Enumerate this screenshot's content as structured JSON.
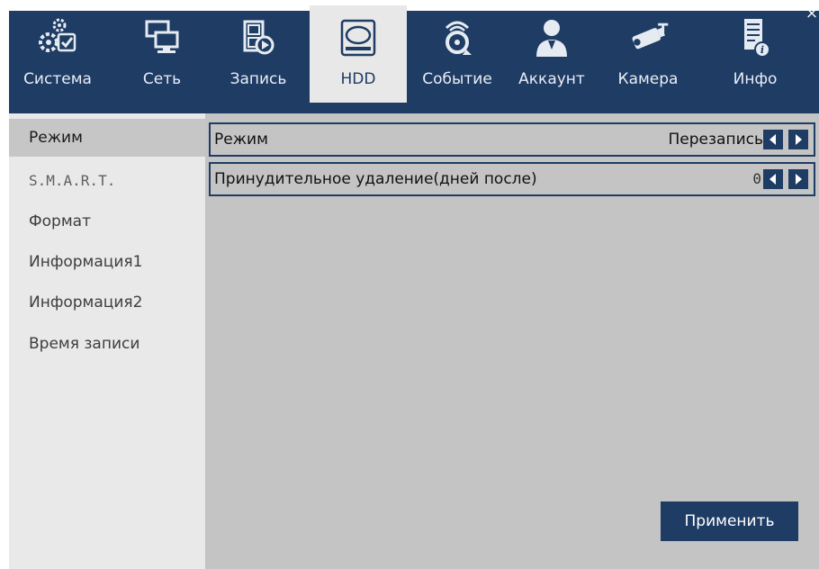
{
  "window": {
    "close_symbol": "×"
  },
  "tabs": [
    {
      "label": "Система",
      "icon": "gear-check-icon",
      "active": false
    },
    {
      "label": "Сеть",
      "icon": "network-monitors-icon",
      "active": false
    },
    {
      "label": "Запись",
      "icon": "film-record-icon",
      "active": false
    },
    {
      "label": "HDD",
      "icon": "hard-drive-icon",
      "active": true
    },
    {
      "label": "Событие",
      "icon": "alarm-event-icon",
      "active": false
    },
    {
      "label": "Аккаунт",
      "icon": "user-account-icon",
      "active": false
    },
    {
      "label": "Камера",
      "icon": "camera-icon",
      "active": false
    },
    {
      "label": "Инфо",
      "icon": "info-document-icon",
      "active": false
    }
  ],
  "sidebar": {
    "items": [
      {
        "label": "Режим",
        "selected": true
      },
      {
        "label": "S.M.A.R.T.",
        "selected": false
      },
      {
        "label": "Формат",
        "selected": false
      },
      {
        "label": "Информация1",
        "selected": false
      },
      {
        "label": "Информация2",
        "selected": false
      },
      {
        "label": "Время записи",
        "selected": false
      }
    ]
  },
  "settings": {
    "mode": {
      "label": "Режим",
      "value": "Перезапись"
    },
    "force_delete": {
      "label": "Принудительное удаление(дней после)",
      "value": "0"
    }
  },
  "apply_label": "Применить",
  "colors": {
    "header_bg": "#1e3c64",
    "active_tab_bg": "#e8e8e8",
    "sidebar_bg": "#e9e9e9",
    "sidebar_selected_bg": "#c6c6c6",
    "content_bg": "#c4c4c4",
    "accent": "#1e3c64"
  }
}
